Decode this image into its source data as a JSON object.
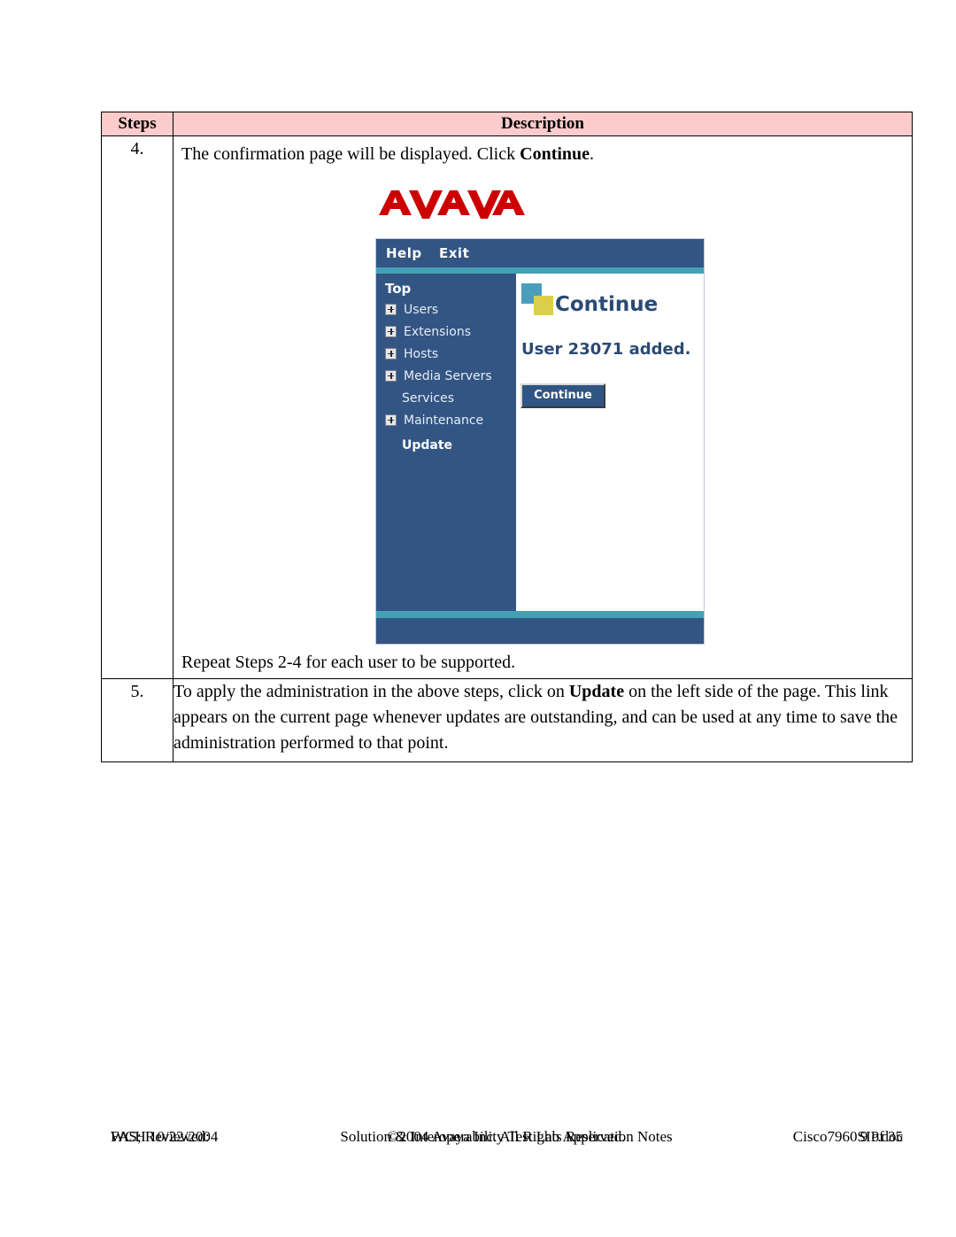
{
  "table": {
    "headers": [
      "Steps",
      "Description"
    ],
    "rows": [
      {
        "step": "4.",
        "text_before": "The confirmation page will be displayed.  Click ",
        "text_bold": "Continue",
        "text_after": ".",
        "repeat_note": "Repeat Steps 2-4 for each user to be supported."
      },
      {
        "step": "5.",
        "text_before": "To apply the administration in the above steps, click on ",
        "text_bold": "Update",
        "text_after": " on the left side of the page.  This link appears on the current page whenever updates are outstanding, and can be used at any time to save the administration performed to that point."
      }
    ]
  },
  "screenshot": {
    "logo_text": "AVAYA",
    "logo_color": "#CC0000",
    "navbar": {
      "help_label": "Help",
      "exit_label": "Exit",
      "background": "#325584"
    },
    "accent_teal": "#45A0B5",
    "sidebar": {
      "top_label": "Top",
      "items": [
        {
          "label": "Users",
          "expandable": true,
          "bold": false
        },
        {
          "label": "Extensions",
          "expandable": true,
          "bold": false
        },
        {
          "label": "Hosts",
          "expandable": true,
          "bold": false
        },
        {
          "label": "Media Servers",
          "expandable": true,
          "bold": false
        },
        {
          "label": "Services",
          "expandable": false,
          "bold": false
        },
        {
          "label": "Maintenance",
          "expandable": true,
          "bold": false
        },
        {
          "label": "Update",
          "expandable": false,
          "bold": true
        }
      ]
    },
    "content": {
      "title": "Continue",
      "message": "User 23071 added.",
      "button_label": "Continue",
      "icon_teal_color": "#4A9EBC",
      "icon_yellow_color": "#DBCF49"
    }
  },
  "footer": {
    "left_line1": "FAS; Reviewed:",
    "left_line2": "WCH 10/22/2004",
    "center_line1": "Solution & Interoperability Test Lab Application Notes",
    "center_line2": "©2004 Avaya Inc. All Rights Reserved.",
    "right_line1": "9 of 35",
    "right_line2": "Cisco7960SIP.doc"
  }
}
